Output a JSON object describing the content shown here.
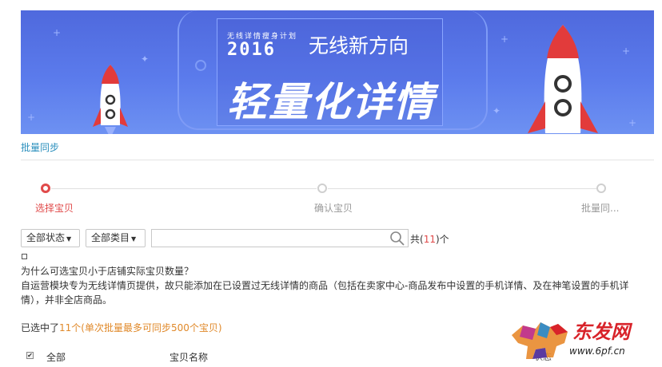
{
  "banner": {
    "small_text": "无线详情瘦身计划",
    "year": "2016",
    "title": "无线新方向",
    "headline": "轻量化详情"
  },
  "link": {
    "batch_sync": "批量同步"
  },
  "steps": [
    {
      "label": "选择宝贝",
      "active": true
    },
    {
      "label": "确认宝贝",
      "active": false
    },
    {
      "label": "批量同...",
      "active": false
    }
  ],
  "filters": {
    "status_dropdown": "全部状态",
    "category_dropdown": "全部类目",
    "search_value": "",
    "count_prefix": "共(",
    "count_value": "11",
    "count_suffix": ")个"
  },
  "faq": {
    "question": "为什么可选宝贝小于店铺实际宝贝数量？",
    "answer": "自运营模块专为无线详情页提供，故只能添加在已设置过无线详情的商品（包括在卖家中心-商品发布中设置的手机详情、及在神笔设置的手机详情），并非全店商品。"
  },
  "selection": {
    "prefix": "已选中了",
    "count": "11个",
    "note": "(单次批量最多可同步500个宝贝)"
  },
  "table_header": {
    "all": "全部",
    "name": "宝贝名称",
    "status": "状态"
  },
  "watermark": {
    "brand": "东发网",
    "url": "www.6pf.cn"
  },
  "colors": {
    "accent_red": "#e04a4a",
    "link_blue": "#2a8fbd",
    "highlight_orange": "#e0892a",
    "banner_blue": "#5b7bec"
  }
}
